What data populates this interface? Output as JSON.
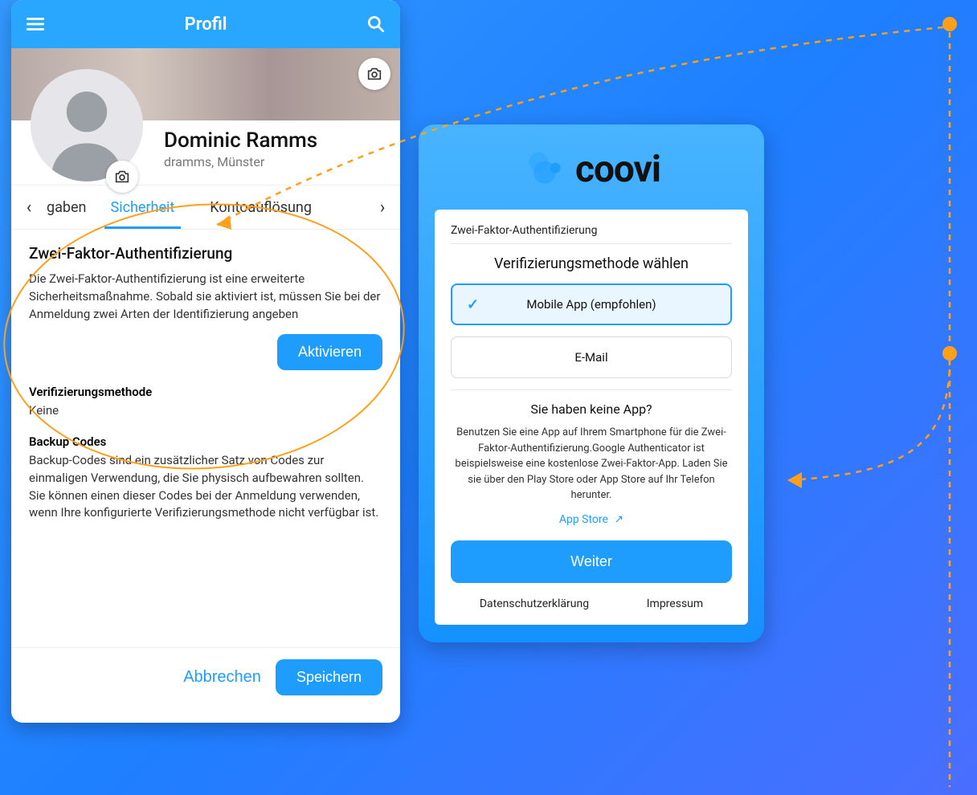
{
  "leftScreen": {
    "appbar": {
      "title": "Profil"
    },
    "profile": {
      "name": "Dominic Ramms",
      "subtitle": "dramms, Münster"
    },
    "tabs": {
      "leftPartial": "gaben",
      "active": "Sicherheit",
      "right": "Kontoauflösung"
    },
    "twofa": {
      "heading": "Zwei-Faktor-Authentifizierung",
      "body": "Die Zwei-Faktor-Authentifizierung ist eine erweiterte Sicherheitsmaßnahme. Sobald sie aktiviert ist, müssen Sie bei der Anmeldung zwei Arten der Identifizierung angeben",
      "activate": "Aktivieren",
      "verMethodLabel": "Verifizierungsmethode",
      "verMethodValue": "Keine",
      "backupLabel": "Backup Codes",
      "backupBody": "Backup-Codes sind ein zusätzlicher Satz von Codes zur einmaligen Verwendung, die Sie physisch aufbewahren sollten. Sie können einen dieser Codes bei der Anmeldung verwenden, wenn Ihre konfigurierte Verifizierungsmethode nicht verfügbar ist."
    },
    "actions": {
      "cancel": "Abbrechen",
      "save": "Speichern"
    }
  },
  "rightScreen": {
    "brand": "coovi",
    "cardTitle": "Zwei-Faktor-Authentifizierung",
    "heading": "Verifizierungsmethode wählen",
    "optionA": "Mobile App (empfohlen)",
    "optionB": "E-Mail",
    "noAppHeading": "Sie haben keine App?",
    "noAppBody": "Benutzen Sie eine App auf Ihrem Smartphone für die Zwei-Faktor-Authentifizierung.Google Authenticator ist beispielsweise eine kostenlose Zwei-Faktor-App. Laden Sie sie über den Play Store oder App Store auf Ihr Telefon herunter.",
    "appStore": "App Store",
    "next": "Weiter",
    "footer": {
      "privacy": "Datenschutzerklärung",
      "imprint": "Impressum"
    }
  }
}
